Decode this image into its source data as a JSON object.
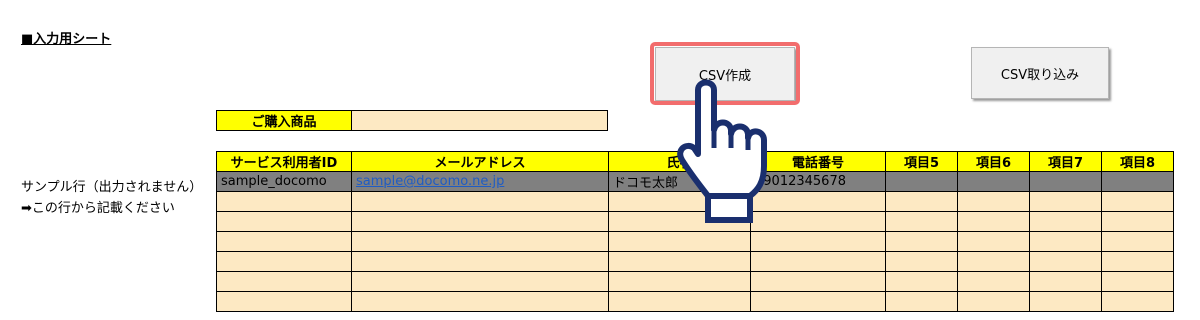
{
  "sheet_title": "■入力用シート",
  "buttons": {
    "csv_create": "CSV作成",
    "csv_import": "CSV取り込み"
  },
  "purchase": {
    "label": "ご購入商品",
    "value": ""
  },
  "table": {
    "headers": [
      "サービス利用者ID",
      "メールアドレス",
      "氏名",
      "電話番号",
      "項目5",
      "項目6",
      "項目7",
      "項目8"
    ],
    "sample_row": [
      "sample_docomo",
      "sample@docomo.ne.jp",
      "ドコモ太郎",
      "09012345678",
      "",
      "",
      "",
      ""
    ],
    "blank_rows": 6
  },
  "notes": {
    "sample_row": "サンプル行（出力されません）",
    "start_row": "➡この行から記載ください"
  },
  "colors": {
    "header_yellow": "#ffff00",
    "input_cell": "#fde9c3",
    "sample_gray": "#808080",
    "highlight": "#f26d6d"
  },
  "icons": {
    "cursor": "pointing-hand-icon"
  }
}
